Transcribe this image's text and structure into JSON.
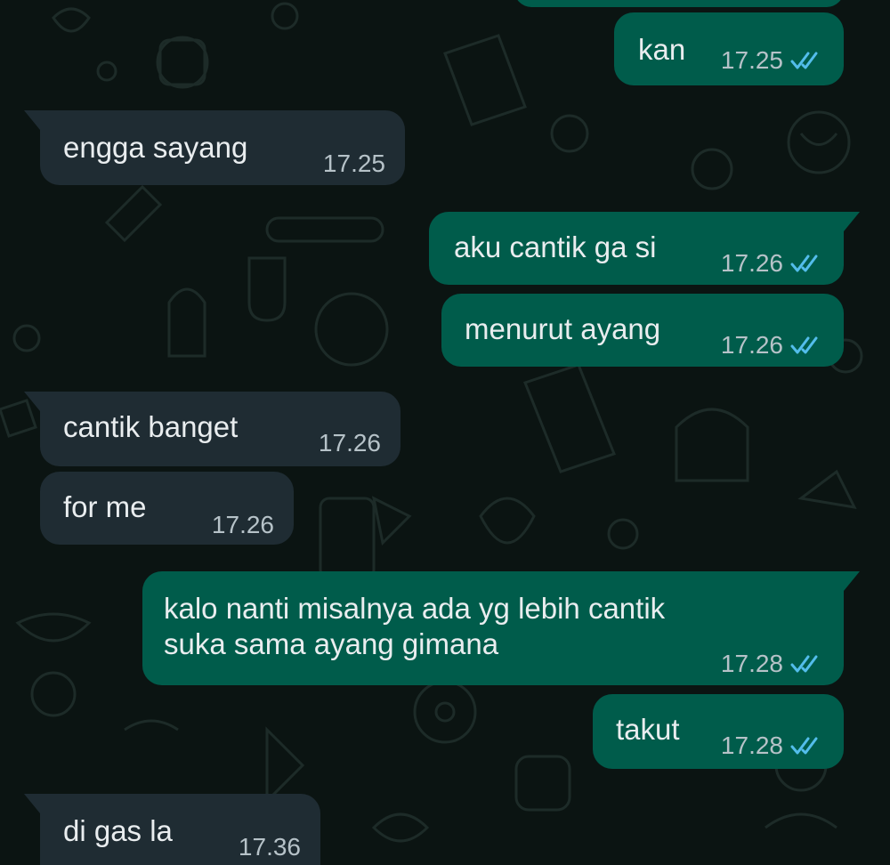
{
  "colors": {
    "background": "#0b1412",
    "incoming_bubble": "#1f2c33",
    "outgoing_bubble": "#005c4b",
    "text": "#e9edef",
    "timestamp": "#b6c2c8",
    "read_tick": "#53bdeb"
  },
  "messages": [
    {
      "direction": "outgoing",
      "text": "kan",
      "time": "17.25",
      "status": "read-double-tick-icon"
    },
    {
      "direction": "incoming",
      "text": "engga sayang",
      "time": "17.25"
    },
    {
      "direction": "outgoing",
      "text": "aku cantik ga si",
      "time": "17.26",
      "status": "read-double-tick-icon"
    },
    {
      "direction": "outgoing",
      "text": "menurut ayang",
      "time": "17.26",
      "status": "read-double-tick-icon"
    },
    {
      "direction": "incoming",
      "text": "cantik banget",
      "time": "17.26"
    },
    {
      "direction": "incoming",
      "text": "for me",
      "time": "17.26"
    },
    {
      "direction": "outgoing",
      "text": "kalo nanti misalnya ada yg lebih cantik\nsuka sama ayang gimana",
      "time": "17.28",
      "status": "read-double-tick-icon"
    },
    {
      "direction": "outgoing",
      "text": "takut",
      "time": "17.28",
      "status": "read-double-tick-icon"
    },
    {
      "direction": "incoming",
      "text": "di gas la",
      "time": "17.36"
    }
  ]
}
